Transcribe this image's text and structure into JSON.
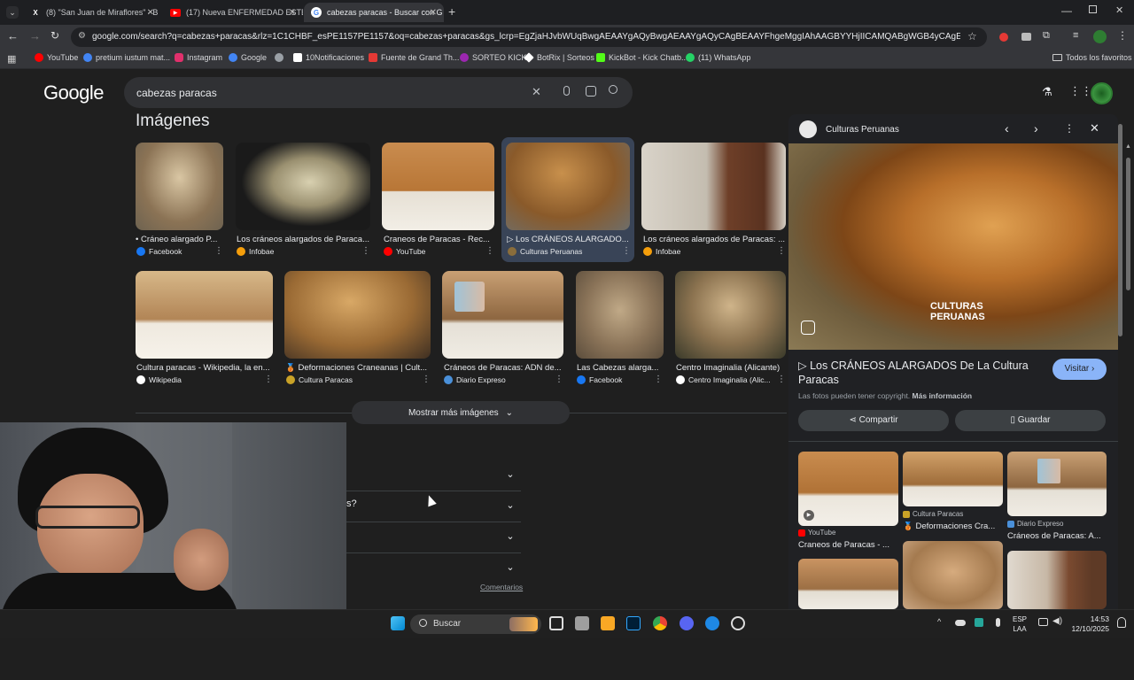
{
  "browser": {
    "tabs": [
      {
        "label": "(8) \"San Juan de Miraflores\" - B",
        "icon": "x-logo-icon"
      },
      {
        "label": "(17) Nueva ENFERMEDAD ESTÉ",
        "icon": "youtube-icon"
      },
      {
        "label": "cabezas paracas - Buscar con G",
        "icon": "google-icon",
        "active": true
      }
    ],
    "url": "google.com/search?q=cabezas+paracas&rlz=1C1CHBF_esPE1157PE1157&oq=cabezas+paracas&gs_lcrp=EgZjaHJvbWUqBwgAEAAYgAQyBwgAEAAYgAQyCAgBEAAYFhgeMggIAhAAGBYYHjIICAMQABgWGB4yCAgEEAAYFhgeMggIBRAAGB...",
    "bookmarks": [
      {
        "label": "YouTube",
        "color": "#ff0000"
      },
      {
        "label": "pretium iustum mat...",
        "color": "#4285f4"
      },
      {
        "label": "Instagram",
        "color": "#e1306c"
      },
      {
        "label": "Google",
        "color": "#4285f4"
      },
      {
        "label": "",
        "color": "#9aa0a6"
      },
      {
        "label": "10Notificaciones",
        "color": "#ffffff"
      },
      {
        "label": "Fuente de Grand Th...",
        "color": "#e53935"
      },
      {
        "label": "SORTEO KICK",
        "color": "#9c27b0"
      },
      {
        "label": "BotRix | Sorteos",
        "color": "#ffffff"
      },
      {
        "label": "KickBot - Kick Chatb...",
        "color": "#53fc18"
      },
      {
        "label": "(11) WhatsApp",
        "color": "#25d366"
      }
    ],
    "all_bookmarks": "Todos los favoritos"
  },
  "google": {
    "logo": "Google",
    "query": "cabezas paracas",
    "section_title": "Imágenes",
    "row1": [
      {
        "caption": "• Cráneo alargado P...",
        "source": "Facebook",
        "src_color": "#1877f2"
      },
      {
        "caption": "Los cráneos alargados de Paraca...",
        "source": "Infobae",
        "src_color": "#f59e0b"
      },
      {
        "caption": "Craneos de Paracas - Rec...",
        "source": "YouTube",
        "src_color": "#ff0000"
      },
      {
        "caption": "▷ Los CRÁNEOS ALARGADO...",
        "source": "Culturas Peruanas",
        "src_color": "#8a6d3b"
      },
      {
        "caption": "Los cráneos alargados de Paracas: ...",
        "source": "Infobae",
        "src_color": "#f59e0b"
      }
    ],
    "row2": [
      {
        "caption": "Cultura paracas - Wikipedia, la en...",
        "source": "Wikipedia",
        "src_color": "#ffffff"
      },
      {
        "caption": "🥉 Deformaciones Craneanas | Cult...",
        "source": "Cultura Paracas",
        "src_color": "#c9a227"
      },
      {
        "caption": "Cráneos de Paracas: ADN de...",
        "source": "Diario Expreso",
        "src_color": "#4a90d9"
      },
      {
        "caption": "Las Cabezas alarga...",
        "source": "Facebook",
        "src_color": "#1877f2"
      },
      {
        "caption": "Centro Imaginalia (Alicante)",
        "source": "Centro Imaginalia (Alic...",
        "src_color": "#ffffff"
      }
    ],
    "more_images": "Mostrar más imágenes",
    "paa_partial": "s?",
    "feedback": "Comentarios"
  },
  "panel": {
    "site": "Culturas Peruanas",
    "watermark": "CULTURAS PERUANAS",
    "title": "▷ Los CRÁNEOS ALARGADOS De La Cultura Paracas",
    "visit": "Visitar",
    "copyright": "Las fotos pueden tener copyright.",
    "more_info": "Más información",
    "share": "Compartir",
    "save": "Guardar",
    "related": [
      {
        "source": "YouTube",
        "caption": "Craneos de Paracas - ..."
      },
      {
        "source": "Cultura Paracas",
        "caption": "🥉 Deformaciones Cra..."
      },
      {
        "source": "Diario Expreso",
        "caption": "Cráneos de Paracas: A..."
      }
    ]
  },
  "taskbar": {
    "search": "Buscar",
    "lang_1": "ESP",
    "lang_2": "LAA",
    "time": "14:53",
    "date": "12/10/2025"
  }
}
